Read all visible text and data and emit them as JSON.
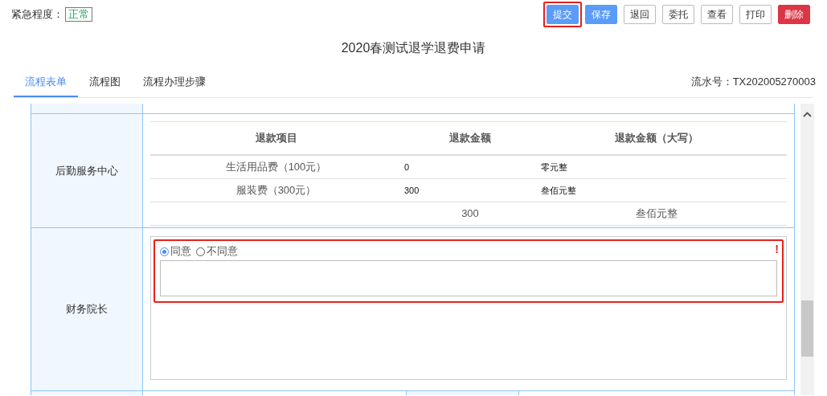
{
  "urgency": {
    "label": "紧急程度：",
    "value": "正常"
  },
  "buttons": [
    {
      "label": "提交",
      "kind": "primary",
      "highlighted": true
    },
    {
      "label": "保存",
      "kind": "primary",
      "highlighted": false
    },
    {
      "label": "退回",
      "kind": "default",
      "highlighted": false
    },
    {
      "label": "委托",
      "kind": "default",
      "highlighted": false
    },
    {
      "label": "查看",
      "kind": "default",
      "highlighted": false
    },
    {
      "label": "打印",
      "kind": "default",
      "highlighted": false
    },
    {
      "label": "删除",
      "kind": "danger",
      "highlighted": false
    }
  ],
  "title": "2020春测试退学退费申请",
  "tabs": [
    {
      "label": "流程表单",
      "selected": true
    },
    {
      "label": "流程图",
      "selected": false
    },
    {
      "label": "流程办理步骤",
      "selected": false
    }
  ],
  "serial": "流水号：TX202005270003",
  "sections": [
    {
      "label": "后勤服务中心",
      "refund_table": {
        "columns": [
          "退款项目",
          "退款金额",
          "退款金额（大写）"
        ],
        "rows": [
          [
            "生活用品费（100元）",
            "0",
            "零元整"
          ],
          [
            "服装费（300元）",
            "300",
            "叁佰元整"
          ]
        ],
        "total": {
          "amount": "300",
          "amount_words": "叁佰元整"
        }
      }
    },
    {
      "label": "财务院长",
      "approval": {
        "options": [
          {
            "label": "同意",
            "selected": true
          },
          {
            "label": "不同意",
            "selected": false
          }
        ],
        "required_mark": "!",
        "highlighted": true
      }
    }
  ]
}
